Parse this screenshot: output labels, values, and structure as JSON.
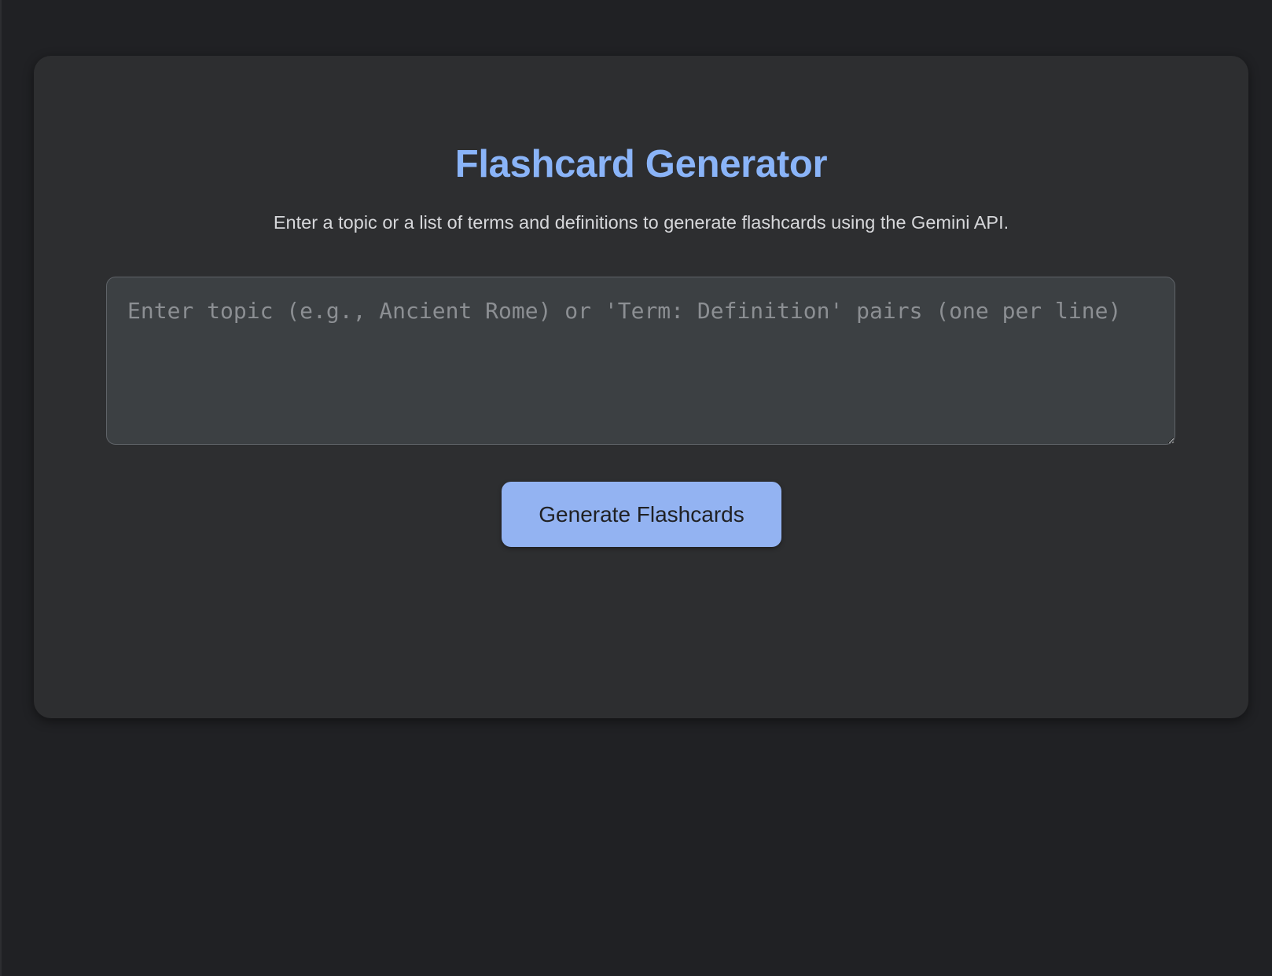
{
  "app": {
    "title": "Flashcard Generator",
    "subtitle": "Enter a topic or a list of terms and definitions to generate flashcards using the Gemini API."
  },
  "input": {
    "value": "",
    "placeholder": "Enter topic (e.g., Ancient Rome) or 'Term: Definition' pairs (one per line)"
  },
  "actions": {
    "generate_label": "Generate Flashcards"
  },
  "colors": {
    "page_background": "#202124",
    "card_background": "#2d2e30",
    "accent": "#8ab4f8",
    "button_background": "#93b3f2",
    "input_background": "#3c4043"
  }
}
